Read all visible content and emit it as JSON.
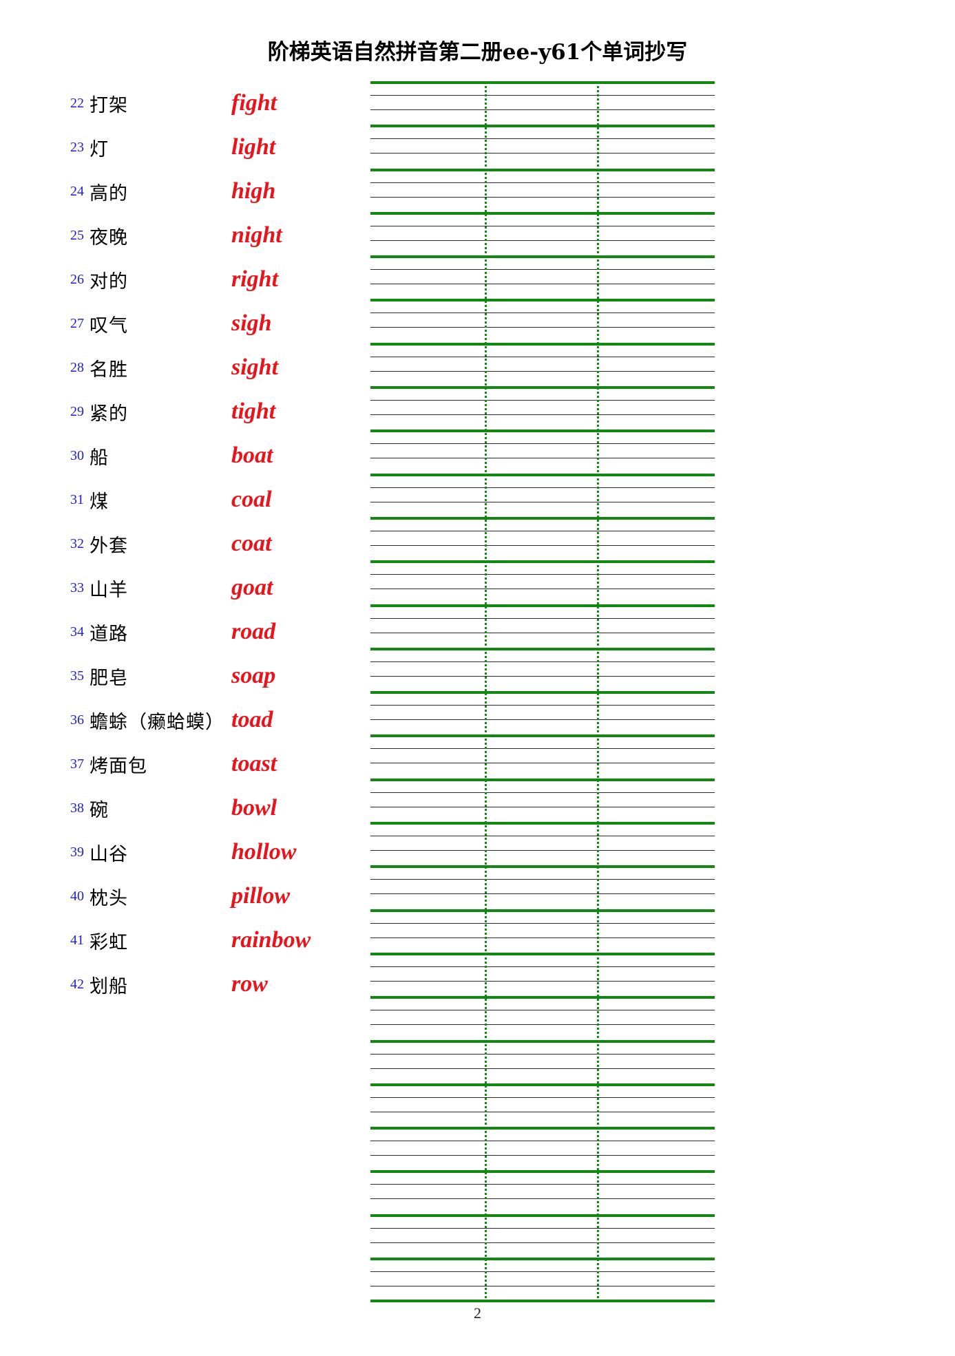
{
  "document": {
    "title": "阶梯英语自然拼音第二册ee-y61个单词抄写",
    "page_number": "2"
  },
  "colors": {
    "index_blue": "#1f1fc8",
    "word_red": "#e8141b",
    "rule_green": "#118811",
    "rule_black": "#2b2b2b",
    "text_black": "#000000"
  },
  "word_list": [
    {
      "index": "22",
      "chinese": "打架",
      "english": "fight"
    },
    {
      "index": "23",
      "chinese": "灯",
      "english": "light"
    },
    {
      "index": "24",
      "chinese": "高的",
      "english": "high"
    },
    {
      "index": "25",
      "chinese": "夜晚",
      "english": "night"
    },
    {
      "index": "26",
      "chinese": "对的",
      "english": "right"
    },
    {
      "index": "27",
      "chinese": "叹气",
      "english": "sigh"
    },
    {
      "index": "28",
      "chinese": "名胜",
      "english": "sight"
    },
    {
      "index": "29",
      "chinese": "紧的",
      "english": "tight"
    },
    {
      "index": "30",
      "chinese": "船",
      "english": "boat"
    },
    {
      "index": "31",
      "chinese": "煤",
      "english": "coal"
    },
    {
      "index": "32",
      "chinese": "外套",
      "english": "coat"
    },
    {
      "index": "33",
      "chinese": "山羊",
      "english": "goat"
    },
    {
      "index": "34",
      "chinese": "道路",
      "english": "road"
    },
    {
      "index": "35",
      "chinese": "肥皂",
      "english": "soap"
    },
    {
      "index": "36",
      "chinese": "蟾蜍（癞蛤蟆）",
      "english": "toad"
    },
    {
      "index": "37",
      "chinese": "烤面包",
      "english": "toast"
    },
    {
      "index": "38",
      "chinese": "碗",
      "english": "bowl"
    },
    {
      "index": "39",
      "chinese": "山谷",
      "english": "hollow"
    },
    {
      "index": "40",
      "chinese": "枕头",
      "english": "pillow"
    },
    {
      "index": "41",
      "chinese": "彩虹",
      "english": "rainbow"
    },
    {
      "index": "42",
      "chinese": "划船",
      "english": "row"
    }
  ],
  "writing_grid": {
    "staff_count": 28,
    "guide_lines_per_staff": 2,
    "vertical_divider_count": 2,
    "style": "four-line-english-copybook"
  }
}
